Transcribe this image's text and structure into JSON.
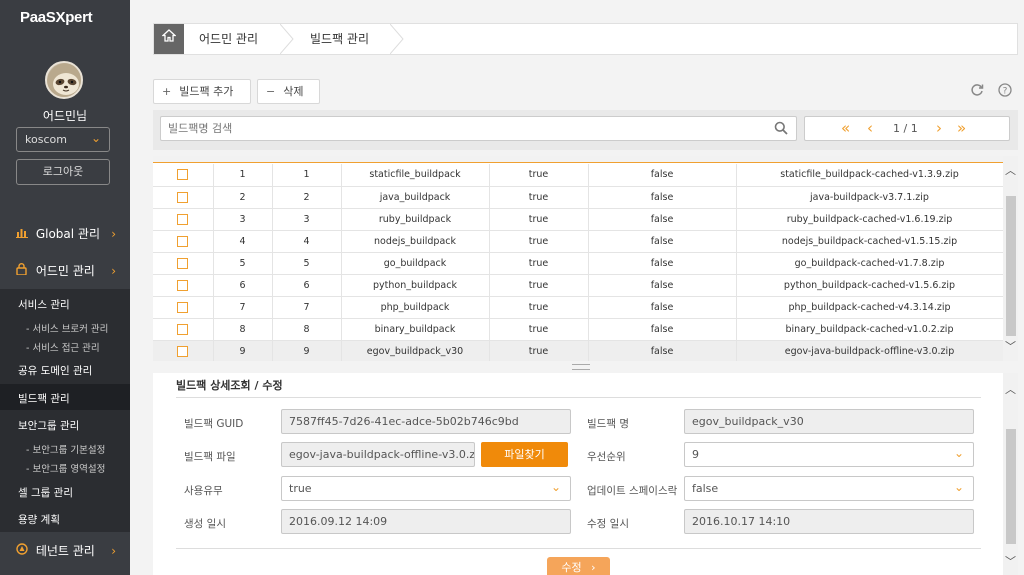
{
  "app": {
    "logo_text": "PaaSXpert"
  },
  "user": {
    "name": "어드민님",
    "org": "koscom",
    "logout_label": "로그아웃"
  },
  "sidebar": {
    "menus": [
      {
        "label": "Global 관리",
        "icon": "bar-chart-icon"
      },
      {
        "label": "어드민 관리",
        "icon": "lock-icon"
      }
    ],
    "items": [
      {
        "label": "서비스 관리"
      },
      {
        "label": "- 서비스 브로커 관리"
      },
      {
        "label": "- 서비스 접근 관리"
      },
      {
        "label": "공유 도메인 관리"
      },
      {
        "label": "빌드팩 관리"
      },
      {
        "label": "보안그룹 관리"
      },
      {
        "label": "- 보안그룹 기본설정"
      },
      {
        "label": "- 보안그룹 영역설정"
      },
      {
        "label": "셀 그룹 관리"
      },
      {
        "label": "용량 계획"
      }
    ],
    "bottom_menu": {
      "label": "테넌트 관리",
      "icon": "tenant-icon"
    }
  },
  "breadcrumb": {
    "items": [
      "어드민 관리",
      "빌드팩 관리"
    ]
  },
  "toolbar": {
    "add_label": "빌드팩 추가",
    "delete_label": "삭제"
  },
  "search": {
    "placeholder": "빌드팩명 검색",
    "value": "빌드팩명 검색"
  },
  "pagination": {
    "text": "1 / 1",
    "current": 1,
    "total": 1
  },
  "buildpacks": [
    {
      "no": "1",
      "position": "1",
      "name": "staticfile_buildpack",
      "enabled": "true",
      "locked": "false",
      "file": "staticfile_buildpack-cached-v1.3.9.zip"
    },
    {
      "no": "2",
      "position": "2",
      "name": "java_buildpack",
      "enabled": "true",
      "locked": "false",
      "file": "java-buildpack-v3.7.1.zip"
    },
    {
      "no": "3",
      "position": "3",
      "name": "ruby_buildpack",
      "enabled": "true",
      "locked": "false",
      "file": "ruby_buildpack-cached-v1.6.19.zip"
    },
    {
      "no": "4",
      "position": "4",
      "name": "nodejs_buildpack",
      "enabled": "true",
      "locked": "false",
      "file": "nodejs_buildpack-cached-v1.5.15.zip"
    },
    {
      "no": "5",
      "position": "5",
      "name": "go_buildpack",
      "enabled": "true",
      "locked": "false",
      "file": "go_buildpack-cached-v1.7.8.zip"
    },
    {
      "no": "6",
      "position": "6",
      "name": "python_buildpack",
      "enabled": "true",
      "locked": "false",
      "file": "python_buildpack-cached-v1.5.6.zip"
    },
    {
      "no": "7",
      "position": "7",
      "name": "php_buildpack",
      "enabled": "true",
      "locked": "false",
      "file": "php_buildpack-cached-v4.3.14.zip"
    },
    {
      "no": "8",
      "position": "8",
      "name": "binary_buildpack",
      "enabled": "true",
      "locked": "false",
      "file": "binary_buildpack-cached-v1.0.2.zip"
    },
    {
      "no": "9",
      "position": "9",
      "name": "egov_buildpack_v30",
      "enabled": "true",
      "locked": "false",
      "file": "egov-java-buildpack-offline-v3.0.zip"
    }
  ],
  "detail": {
    "title": "빌드팩 상세조회 / 수정",
    "guid_label": "빌드팩 GUID",
    "guid_value": "7587ff45-7d26-41ec-adce-5b02b746c9bd",
    "name_label": "빌드팩 명",
    "name_value": "egov_buildpack_v30",
    "file_label": "빌드팩 파일",
    "file_value": "egov-java-buildpack-offline-v3.0.z",
    "file_button": "파일찾기",
    "priority_label": "우선순위",
    "priority_value": "9",
    "enabled_label": "사용유무",
    "enabled_value": "true",
    "update_label": "업데이트 스페이스락",
    "update_value": "false",
    "created_label": "생성 일시",
    "created_value": "2016.09.12 14:09",
    "modified_label": "수정 일시",
    "modified_value": "2016.10.17 14:10",
    "save_label": "수정"
  },
  "colors": {
    "accent": "#f0a030",
    "sidebar_bg": "#3a3d42",
    "sidebar_sub_bg": "#2b2d31",
    "file_button": "#f08a0a"
  }
}
